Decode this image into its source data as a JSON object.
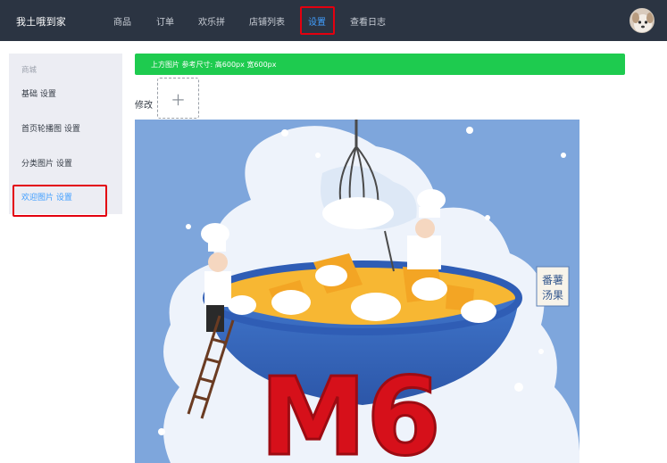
{
  "navbar": {
    "brand": "我土哦到家",
    "items": [
      "商品",
      "订单",
      "欢乐拼",
      "店铺列表",
      "设置",
      "查看日志"
    ],
    "active_index": 4,
    "avatar_icon": "avatar-dog-icon"
  },
  "sidebar": {
    "group_label": "商城",
    "items": [
      "基础 设置",
      "首页轮播图 设置",
      "分类图片 设置",
      "欢迎图片 设置"
    ],
    "active_index": 3
  },
  "main": {
    "tip": "上方图片 参考尺寸: 高600px 宽600px",
    "edit_label": "修改",
    "upload_icon": "plus-icon"
  },
  "poster": {
    "big_text": "M6",
    "stamp_line1": "番薯",
    "stamp_line2": "汤果"
  },
  "colors": {
    "navbar_bg": "#2b3442",
    "active_blue": "#409eff",
    "tip_green": "#1ecb4f",
    "highlight_red": "#e3000f"
  }
}
